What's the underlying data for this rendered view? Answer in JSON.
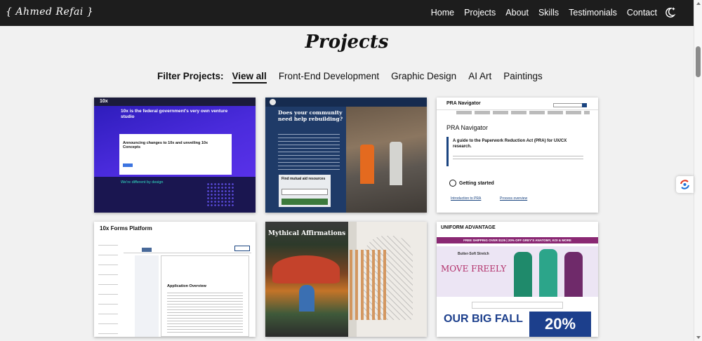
{
  "header": {
    "brand": "{ Ahmed Refai }",
    "nav": [
      "Home",
      "Projects",
      "About",
      "Skills",
      "Testimonials",
      "Contact"
    ],
    "theme_toggle_icon": "moon-sparkle-icon"
  },
  "page": {
    "title": "Projects",
    "filter_label": "Filter Projects:",
    "filters": [
      "View all",
      "Front-End Development",
      "Graphic Design",
      "AI Art",
      "Paintings"
    ],
    "active_filter": "View all"
  },
  "cards": [
    {
      "site": "10x",
      "headline": "10x is the federal government's very own venture studio",
      "box_heading": "Announcing changes to 10x and unveiling 10x Concepts",
      "section": "We're different by design"
    },
    {
      "headline": "Does your community need help rebuilding?",
      "panel_title": "Find mutual aid resources"
    },
    {
      "site": "PRA Navigator",
      "heading": "PRA Navigator",
      "panel_heading": "A guide to the Paperwork Reduction Act (PRA) for UX/CX research.",
      "section": "Getting started",
      "link1": "Introduction to PRA",
      "link2": "Process overview"
    },
    {
      "site": "10x Forms Platform",
      "doc_heading": "Application Overview"
    },
    {
      "title": "Mythical Affirmations"
    },
    {
      "site": "UNIFORM ADVANTAGE",
      "promo": "FREE SHIPPING OVER $125 | 20% OFF GREY'S ANATOMY, KOI & MORE",
      "brand_tag": "Butter-Soft Stretch",
      "hero_text": "MOVE FREELY",
      "ad_text": "OUR BIG FALL",
      "ad_pct": "20%"
    }
  ]
}
